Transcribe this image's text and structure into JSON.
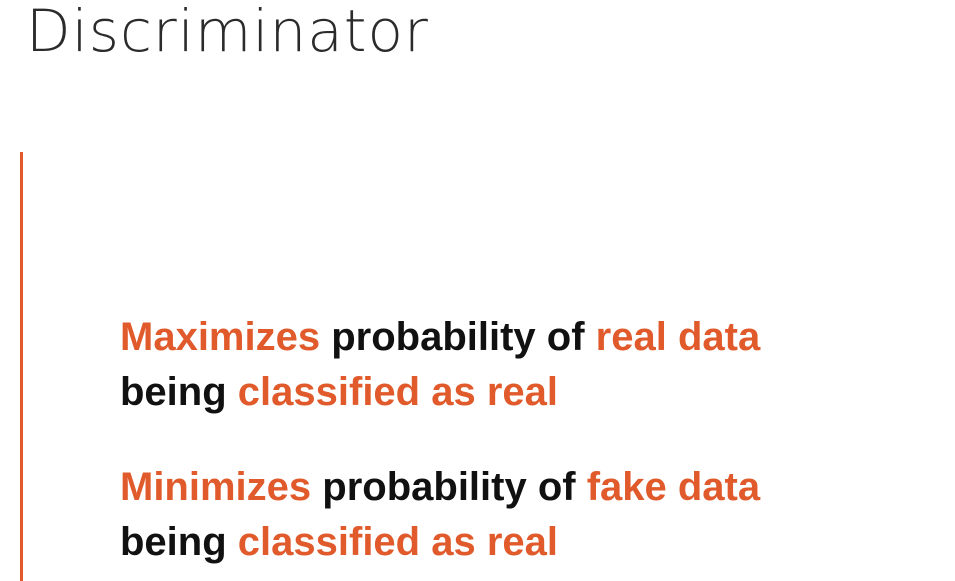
{
  "slide": {
    "title": "Discriminator",
    "accent_color": "#e05a2b",
    "bullets": [
      {
        "line1": {
          "part1": "Maximizes",
          "part2": " probability of ",
          "part3": "real data"
        },
        "line2": {
          "part1": "being ",
          "part2": "classified as real"
        }
      },
      {
        "line1": {
          "part1": "Minimizes",
          "part2": " probability of ",
          "part3": "fake data"
        },
        "line2": {
          "part1": "being ",
          "part2": "classified as real"
        }
      }
    ]
  }
}
